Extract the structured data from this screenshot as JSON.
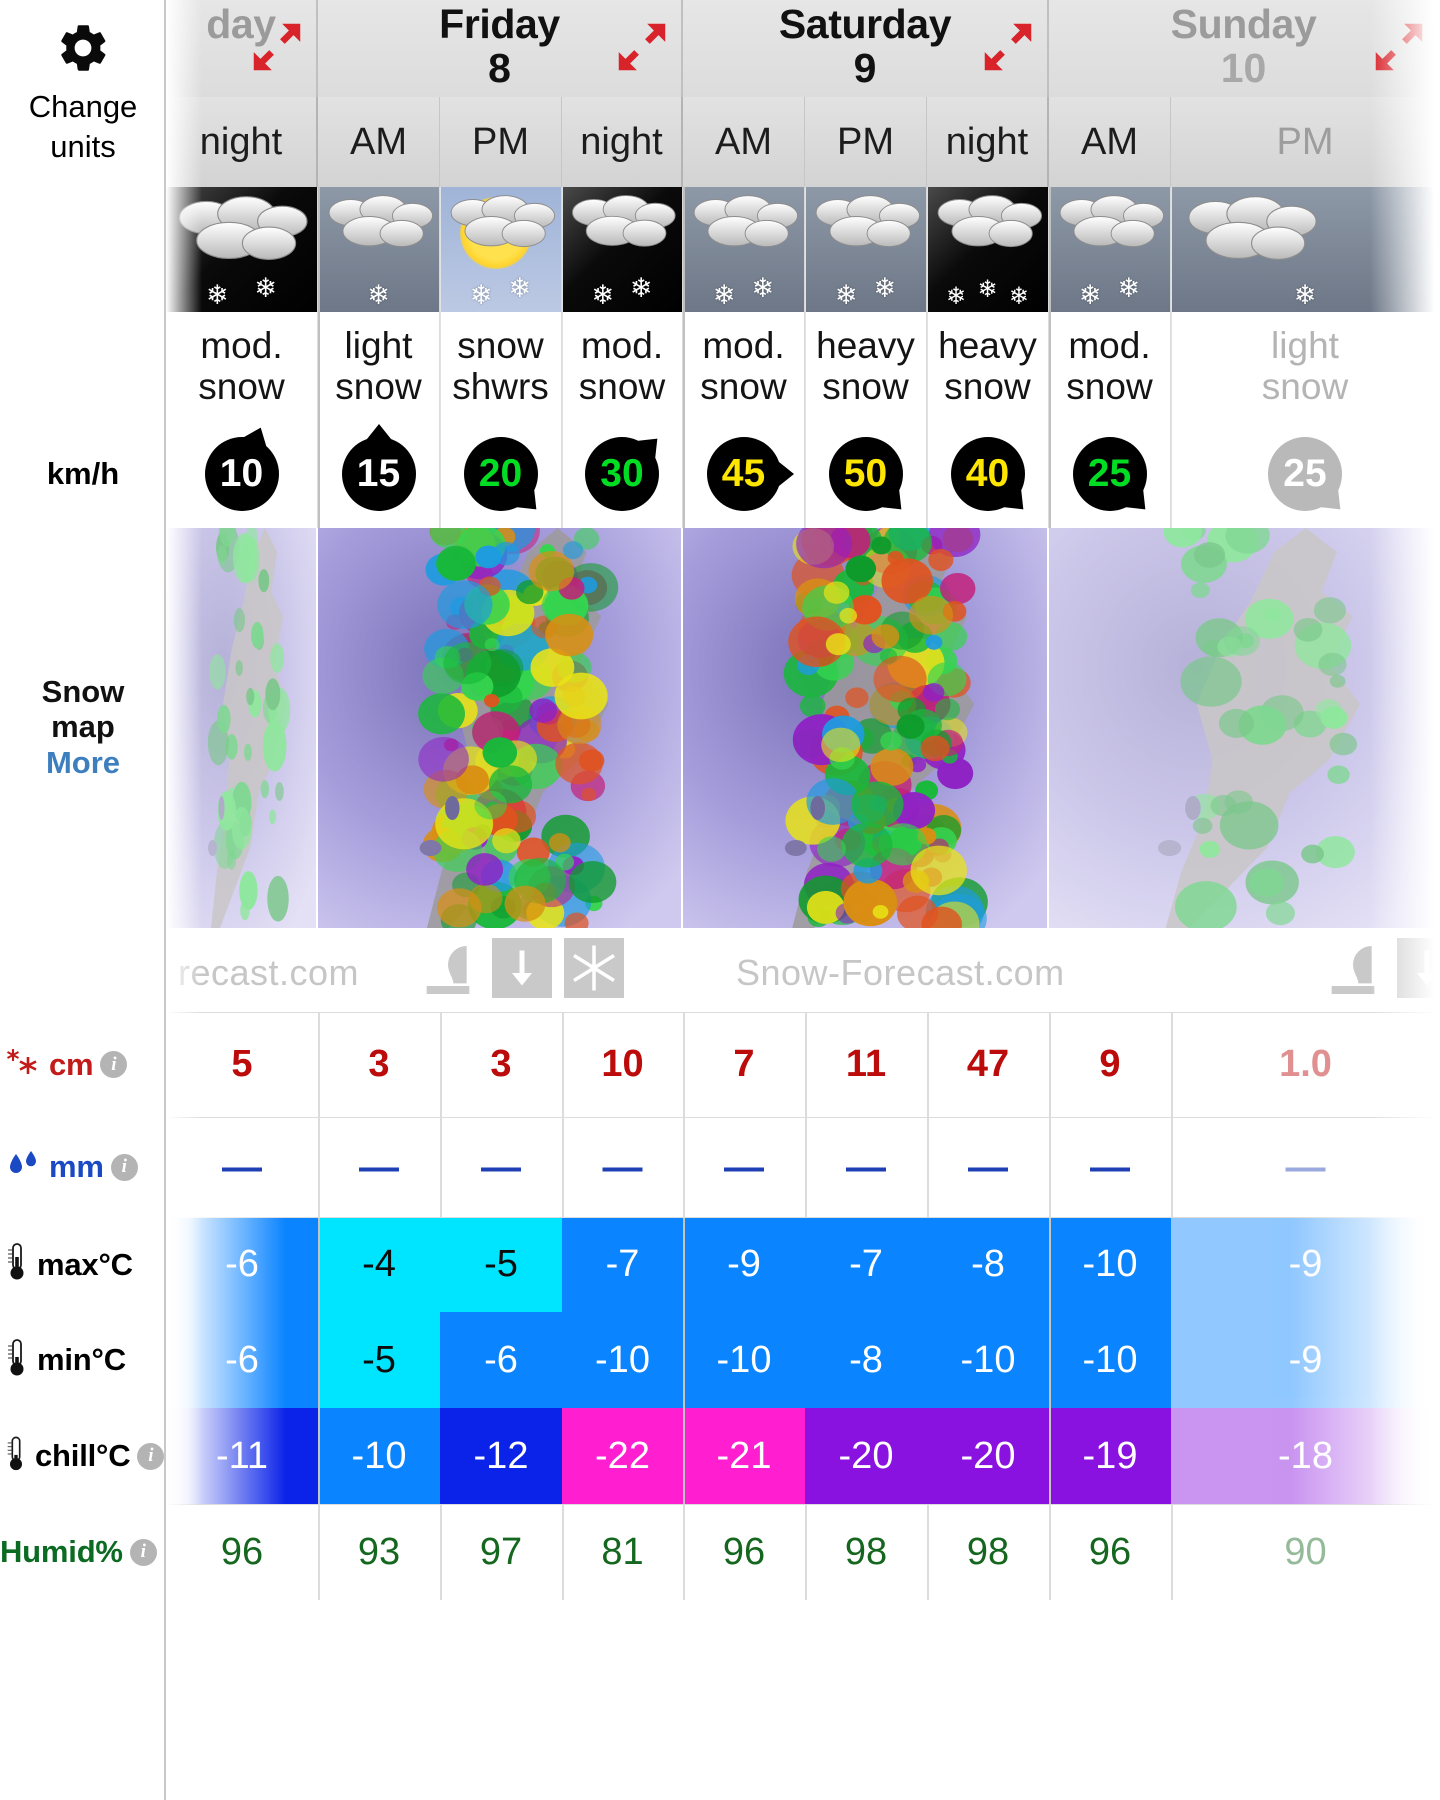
{
  "sidebar": {
    "change_units": {
      "label_line1": "Change",
      "label_line2": "units",
      "icon": "gear-icon"
    },
    "wind_unit_label": "km/h",
    "snow_map": {
      "line1": "Snow",
      "line2": "map",
      "more": "More"
    },
    "rows": [
      {
        "key": "cm",
        "label": "cm",
        "icon": "snowflake-icon",
        "info": "i"
      },
      {
        "key": "mm",
        "label": "mm",
        "icon": "raindrop-icon",
        "info": "i"
      },
      {
        "key": "max",
        "label": "max°C",
        "icon": "thermometer-icon"
      },
      {
        "key": "min",
        "label": "min°C",
        "icon": "thermometer-icon"
      },
      {
        "key": "chill",
        "label": "chill°C",
        "icon": "thermometer-icon",
        "info": "i"
      },
      {
        "key": "humid",
        "label": "Humid%",
        "icon": "",
        "info": "i"
      }
    ]
  },
  "watermark": {
    "left_partial": "recast.com",
    "center": "Snow-Forecast.com"
  },
  "days": [
    {
      "name": "day",
      "number": "",
      "partial": true,
      "expand_icon": "expand-arrows-icon"
    },
    {
      "name": "Friday",
      "number": "8",
      "partial": false,
      "expand_icon": "expand-arrows-icon"
    },
    {
      "name": "Saturday",
      "number": "9",
      "partial": false,
      "expand_icon": "expand-arrows-icon"
    },
    {
      "name": "Sunday",
      "number": "10",
      "partial": true,
      "expand_icon": "expand-arrows-icon"
    }
  ],
  "columns": [
    {
      "day": 0,
      "period": "night",
      "weather": "mod. snow",
      "sky": "night",
      "flakes": 2,
      "sun": false,
      "wind": "10",
      "wind_color": "#ffffff",
      "wind_dir": "NNE",
      "wind_faded": false,
      "cm": "5",
      "mm": "—",
      "max": "-6",
      "min": "-6",
      "chill": "-11",
      "humid": "96",
      "faded": false
    },
    {
      "day": 1,
      "period": "AM",
      "weather": "light snow",
      "sky": "cloudy",
      "flakes": 1,
      "sun": false,
      "wind": "15",
      "wind_color": "#ffffff",
      "wind_dir": "N",
      "wind_faded": false,
      "cm": "3",
      "mm": "—",
      "max": "-4",
      "min": "-5",
      "chill": "-10",
      "humid": "93",
      "faded": false
    },
    {
      "day": 1,
      "period": "PM",
      "weather": "snow shwrs",
      "sky": "sun",
      "flakes": 2,
      "sun": true,
      "wind": "20",
      "wind_color": "#00dd22",
      "wind_dir": "SE",
      "wind_faded": false,
      "cm": "3",
      "mm": "—",
      "max": "-5",
      "min": "-6",
      "chill": "-12",
      "humid": "97",
      "faded": false
    },
    {
      "day": 1,
      "period": "night",
      "weather": "mod. snow",
      "sky": "night",
      "flakes": 2,
      "sun": false,
      "wind": "30",
      "wind_color": "#00dd22",
      "wind_dir": "NE",
      "wind_faded": false,
      "cm": "10",
      "mm": "—",
      "max": "-7",
      "min": "-10",
      "chill": "-22",
      "humid": "81",
      "faded": false
    },
    {
      "day": 2,
      "period": "AM",
      "weather": "mod. snow",
      "sky": "cloudy",
      "flakes": 2,
      "sun": false,
      "wind": "45",
      "wind_color": "#ffe600",
      "wind_dir": "E",
      "wind_faded": false,
      "cm": "7",
      "mm": "—",
      "max": "-9",
      "min": "-10",
      "chill": "-21",
      "humid": "96",
      "faded": false
    },
    {
      "day": 2,
      "period": "PM",
      "weather": "heavy snow",
      "sky": "cloudy",
      "flakes": 2,
      "sun": false,
      "wind": "50",
      "wind_color": "#ffe600",
      "wind_dir": "SE",
      "wind_faded": false,
      "cm": "11",
      "mm": "—",
      "max": "-7",
      "min": "-8",
      "chill": "-20",
      "humid": "98",
      "faded": false
    },
    {
      "day": 2,
      "period": "night",
      "weather": "heavy snow",
      "sky": "night",
      "flakes": 3,
      "sun": false,
      "wind": "40",
      "wind_color": "#ffe600",
      "wind_dir": "SE",
      "wind_faded": false,
      "cm": "47",
      "mm": "—",
      "max": "-8",
      "min": "-10",
      "chill": "-20",
      "humid": "98",
      "faded": false
    },
    {
      "day": 3,
      "period": "AM",
      "weather": "mod. snow",
      "sky": "cloudy",
      "flakes": 2,
      "sun": false,
      "wind": "25",
      "wind_color": "#00dd22",
      "wind_dir": "SE",
      "wind_faded": false,
      "cm": "9",
      "mm": "—",
      "max": "-10",
      "min": "-10",
      "chill": "-19",
      "humid": "96",
      "faded": false
    },
    {
      "day": 3,
      "period": "PM",
      "weather": "light snow",
      "sky": "cloudy",
      "flakes": 1,
      "sun": false,
      "wind": "25",
      "wind_color": "#00dd22",
      "wind_dir": "SE",
      "wind_faded": true,
      "cm": "1.0",
      "mm": "—",
      "max": "-9",
      "min": "-9",
      "chill": "-18",
      "humid": "90",
      "faded": true
    }
  ],
  "chart_data": {
    "type": "table",
    "title": "Snow-Forecast.com 3-day snow forecast table",
    "categories": [
      "day night",
      "Fri 8 AM",
      "Fri 8 PM",
      "Fri 8 night",
      "Sat 9 AM",
      "Sat 9 PM",
      "Sat 9 night",
      "Sun 10 AM",
      "Sun 10 PM"
    ],
    "series": [
      {
        "name": "Snow cm",
        "values": [
          5,
          3,
          3,
          10,
          7,
          11,
          47,
          9,
          1.0
        ]
      },
      {
        "name": "Rain mm",
        "values": [
          null,
          null,
          null,
          null,
          null,
          null,
          null,
          null,
          null
        ]
      },
      {
        "name": "max °C",
        "values": [
          -6,
          -4,
          -5,
          -7,
          -9,
          -7,
          -8,
          -10,
          -9
        ]
      },
      {
        "name": "min °C",
        "values": [
          -6,
          -5,
          -6,
          -10,
          -10,
          -8,
          -10,
          -10,
          -9
        ]
      },
      {
        "name": "chill °C",
        "values": [
          -11,
          -10,
          -12,
          -22,
          -21,
          -20,
          -20,
          -19,
          -18
        ]
      },
      {
        "name": "Humidity %",
        "values": [
          96,
          93,
          97,
          81,
          96,
          98,
          98,
          96,
          90
        ]
      },
      {
        "name": "Wind km/h",
        "values": [
          10,
          15,
          20,
          30,
          45,
          50,
          40,
          25,
          25
        ]
      }
    ],
    "ylabel": "",
    "xlabel": "",
    "grid": true,
    "legend": "left-column"
  }
}
